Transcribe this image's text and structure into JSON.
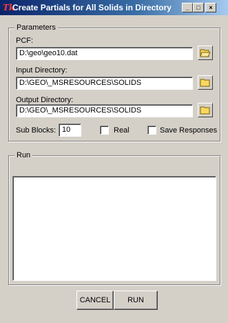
{
  "window": {
    "title": "Create Partials for All Solids in Directory",
    "icon": "app-logo-icon",
    "controls": {
      "minimize": "_",
      "maximize": "□",
      "close": "×"
    }
  },
  "parameters": {
    "legend": "Parameters",
    "pcf_label": "PCF:",
    "pcf_value": "D:\\geo\\geo10.dat",
    "input_dir_label": "Input Directory:",
    "input_dir_value": "D:\\GEO\\_MSRESOURCES\\SOLIDS",
    "output_dir_label": "Output Directory:",
    "output_dir_value": "D:\\GEO\\_MSRESOURCES\\SOLIDS",
    "sub_blocks_label": "Sub Blocks:",
    "sub_blocks_value": "10",
    "real_label": "Real",
    "real_checked": false,
    "save_responses_label": "Save Responses",
    "save_responses_checked": false
  },
  "run": {
    "legend": "Run",
    "log_text": ""
  },
  "buttons": {
    "cancel_label": "CANCEL",
    "run_label": "RUN"
  },
  "colors": {
    "title_gradient_start": "#0a246a",
    "title_gradient_end": "#a6caf0",
    "face": "#d4d0c8",
    "folder_yellow": "#f8d860"
  }
}
